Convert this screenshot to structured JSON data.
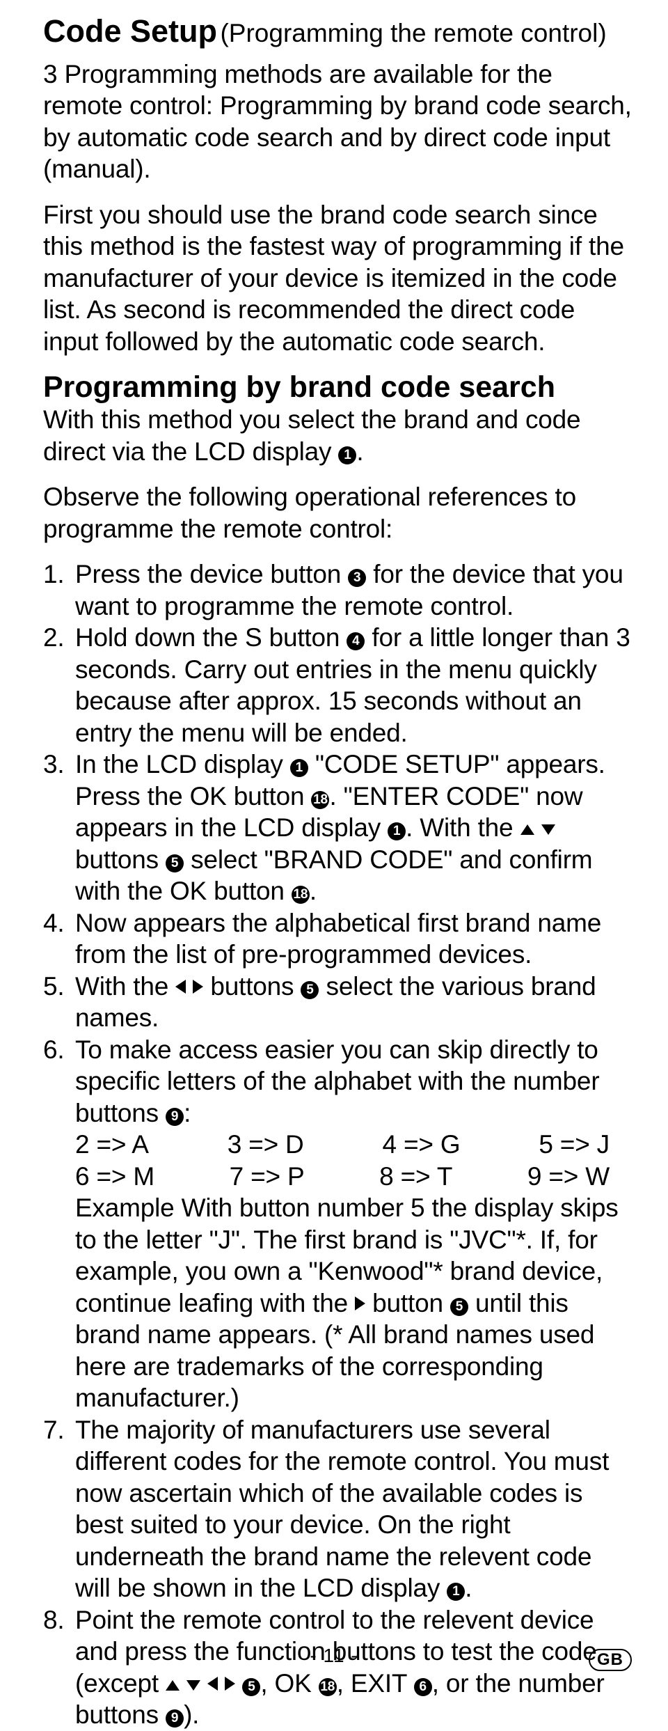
{
  "header": {
    "title": "Code Setup",
    "suffix": "(Programming the remote control)"
  },
  "intro": {
    "p1": "3 Programming methods are available for the remote control: Programming by brand code search, by automatic code search and by direct code input (manual).",
    "p2": "First you should use the brand code search since this method is the fastest way of programming if the manufacturer of your de­vice is itemized in the code list. As second is recommended the direct code input followed by the automatic code search."
  },
  "section": {
    "title": "Programming by brand code search",
    "p1a": "With this method you select the brand and code direct via the LCD display ",
    "p1b": ".",
    "p2": "Observe the following operational references to programme the remote control:"
  },
  "steps": {
    "s1a": "Press the device button ",
    "s1b": " for the device that you want to programme the remote control.",
    "s2a": "Hold down the S button ",
    "s2b": " for a little longer than 3 sec­onds. Carry out entries in the menu quickly because after approx. 15 seconds without an entry the menu will be ended.",
    "s3a": "In the LCD display ",
    "s3b": " \"CODE SETUP\" appears. Press the OK button ",
    "s3c": ". \"ENTER CODE\" now appears in the LCD display ",
    "s3d": ". With the ",
    "s3e": " buttons ",
    "s3f": " select \"BRAND CODE\" and confirm with the OK button ",
    "s3g": ".",
    "s4": "Now appears the alphabetical first brand name from the list of pre-programmed devices.",
    "s5a": "With the ",
    "s5b": " buttons ",
    "s5c": " select the various brand names.",
    "s6a": "To make access easier you can skip directly to specific let­ters of the alphabet with the number buttons ",
    "s6b": ":",
    "s6map1": [
      "2 => A",
      "3 => D",
      "4 => G",
      "5 => J"
    ],
    "s6map2": [
      "6 => M",
      "7 => P",
      "8 => T",
      "9 => W"
    ],
    "s6c": "Example With button number 5 the display skips to the letter \"J\". The first brand is \"JVC\"*. If, for example, you own a \"Kenwood\"* brand device, continue leafing with the ",
    "s6d": " button ",
    "s6e": " until this brand name appears. (* All brand names used here are trademarks of the corre­sponding manufacturer.)",
    "s7a": "The majority of manufacturers use several different codes for the remote control. You must now ascertain which of the available codes is best suited to your device. On the right underneath the brand name the relevent code will be shown in the LCD display ",
    "s7b": ".",
    "s8a": "Point the remote control to the relevent device and press the function buttons to test the code (except ",
    "s8b": ", OK ",
    "s8c": ", EXIT ",
    "s8d": ", or the number buttons ",
    "s8e": ")."
  },
  "refs": {
    "r1": "1",
    "r3": "3",
    "r4": "4",
    "r5": "5",
    "r6": "6",
    "r9": "9",
    "r18": "18"
  },
  "footer": {
    "page": "- 11 -",
    "lang": "GB"
  }
}
